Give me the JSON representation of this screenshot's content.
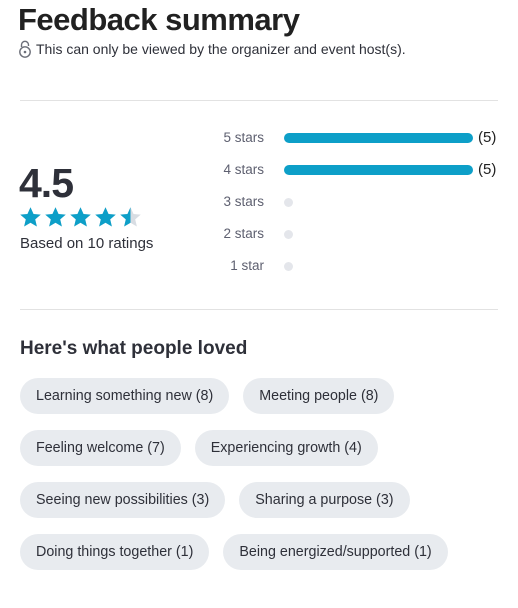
{
  "header": {
    "title": "Feedback summary",
    "privacy_note": "This can only be viewed by the organizer and event host(s)."
  },
  "rating": {
    "average": "4.5",
    "average_value": 4.5,
    "based_on": "Based on 10 ratings",
    "star_color": "#0d9fc8"
  },
  "breakdown": [
    {
      "label": "5 stars",
      "count": "(5)",
      "fraction": 1.0
    },
    {
      "label": "4 stars",
      "count": "(5)",
      "fraction": 1.0
    },
    {
      "label": "3 stars",
      "count": "",
      "fraction": 0
    },
    {
      "label": "2 stars",
      "count": "",
      "fraction": 0
    },
    {
      "label": "1 star",
      "count": "",
      "fraction": 0
    }
  ],
  "loved": {
    "heading": "Here's what people loved",
    "chips": [
      "Learning something new  (8)",
      "Meeting people  (8)",
      "Feeling welcome  (7)",
      "Experiencing growth  (4)",
      "Seeing new possibilities  (3)",
      "Sharing a purpose  (3)",
      "Doing things together  (1)",
      "Being energized/supported  (1)"
    ]
  },
  "icons": {
    "privacy": "lock-icon",
    "star": "star-icon"
  }
}
